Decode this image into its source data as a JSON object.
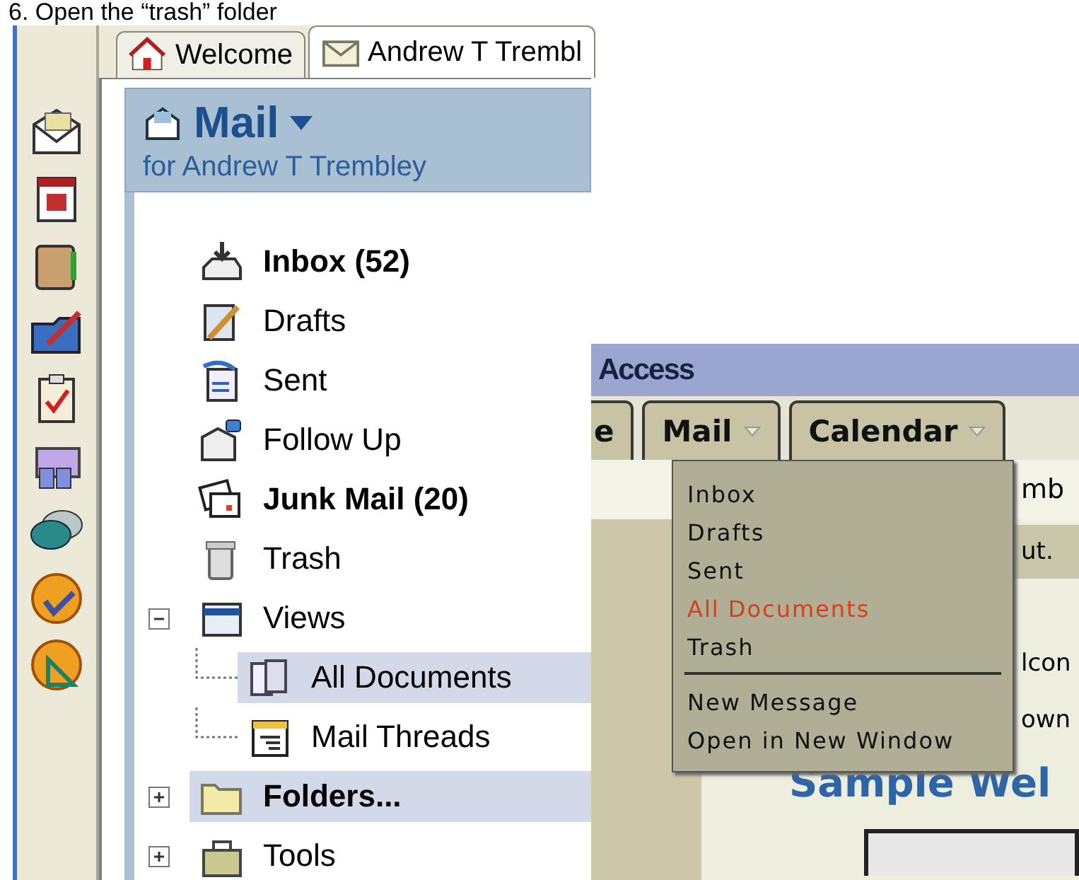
{
  "caption": "6. Open the “trash” folder",
  "left": {
    "tabs": [
      {
        "label": "Welcome",
        "kind": "home",
        "selected": false
      },
      {
        "label": "Andrew T Trembl",
        "kind": "mail",
        "selected": true
      }
    ],
    "header": {
      "title": "Mail",
      "subtitle": "for Andrew T Trembley"
    },
    "tree": [
      {
        "label": "Inbox (52)",
        "kind": "inbox",
        "bold": true,
        "selected": false
      },
      {
        "label": "Drafts",
        "kind": "drafts",
        "bold": false,
        "selected": false
      },
      {
        "label": "Sent",
        "kind": "sent",
        "bold": false,
        "selected": false
      },
      {
        "label": "Follow Up",
        "kind": "followup",
        "bold": false,
        "selected": false
      },
      {
        "label": "Junk Mail (20)",
        "kind": "junk",
        "bold": true,
        "selected": false
      },
      {
        "label": "Trash",
        "kind": "trash",
        "bold": false,
        "selected": false
      },
      {
        "label": "Views",
        "kind": "views",
        "bold": false,
        "selected": false,
        "expanded": true,
        "children": [
          {
            "label": "All Documents",
            "kind": "documents",
            "bold": false,
            "selected": true
          },
          {
            "label": "Mail Threads",
            "kind": "threads",
            "bold": false,
            "selected": false
          }
        ]
      },
      {
        "label": "Folders...",
        "kind": "folder",
        "bold": true,
        "selected": true,
        "expanded": false
      },
      {
        "label": "Tools",
        "kind": "tools",
        "bold": false,
        "selected": false,
        "expanded": false
      }
    ]
  },
  "right": {
    "title": "Access",
    "tabs": [
      {
        "label": "e",
        "dropdown": false
      },
      {
        "label": "Mail",
        "dropdown": true
      },
      {
        "label": "Calendar",
        "dropdown": true
      }
    ],
    "menu": {
      "sections": [
        [
          {
            "label": "Inbox",
            "selected": false
          },
          {
            "label": "Drafts",
            "selected": false
          },
          {
            "label": "Sent",
            "selected": false
          },
          {
            "label": "All Documents",
            "selected": true
          },
          {
            "label": "Trash",
            "selected": false
          }
        ],
        [
          {
            "label": "New Message",
            "selected": false
          },
          {
            "label": "Open in New Window",
            "selected": false
          }
        ]
      ]
    },
    "fragments": {
      "top": "mb",
      "box": "ut.",
      "line_1": "lcon",
      "line_2": "own",
      "heading": "Sample Wel"
    }
  }
}
